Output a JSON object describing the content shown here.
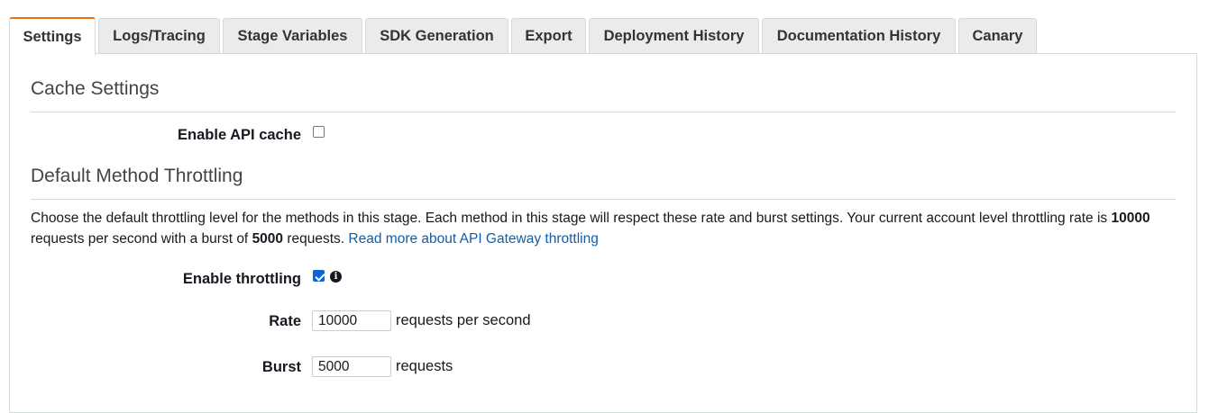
{
  "tabs": [
    {
      "label": "Settings",
      "active": true
    },
    {
      "label": "Logs/Tracing",
      "active": false
    },
    {
      "label": "Stage Variables",
      "active": false
    },
    {
      "label": "SDK Generation",
      "active": false
    },
    {
      "label": "Export",
      "active": false
    },
    {
      "label": "Deployment History",
      "active": false
    },
    {
      "label": "Documentation History",
      "active": false
    },
    {
      "label": "Canary",
      "active": false
    }
  ],
  "cache": {
    "title": "Cache Settings",
    "enable_label": "Enable API cache",
    "enabled": false
  },
  "throttling": {
    "title": "Default Method Throttling",
    "desc_part1": "Choose the default throttling level for the methods in this stage. Each method in this stage will respect these rate and burst settings. Your current account level throttling rate is ",
    "account_rate": "10000",
    "desc_part2": " requests per second with a burst of ",
    "account_burst": "5000",
    "desc_part3": " requests. ",
    "link_text": "Read more about API Gateway throttling",
    "enable_label": "Enable throttling",
    "enabled": true,
    "info_icon": "info-icon",
    "rate_label": "Rate",
    "rate_value": "10000",
    "rate_unit": "requests per second",
    "burst_label": "Burst",
    "burst_value": "5000",
    "burst_unit": "requests"
  },
  "colors": {
    "active_tab_accent": "#ec7211",
    "link": "#0f5eab",
    "checkbox_checked": "#0a66d3"
  }
}
